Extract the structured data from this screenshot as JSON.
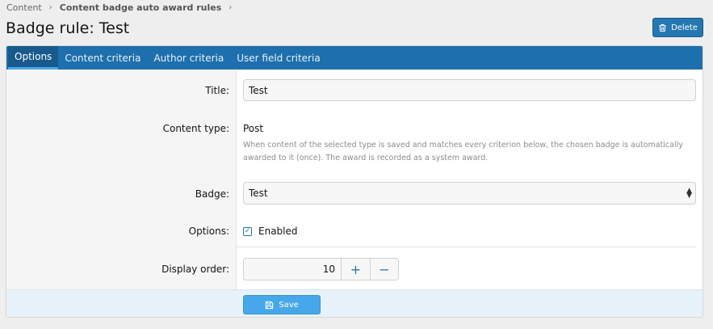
{
  "breadcrumb": [
    {
      "label": "Content"
    },
    {
      "label": "Content badge auto award rules"
    }
  ],
  "page_title": "Badge rule: Test",
  "delete_label": "Delete",
  "tabs": [
    {
      "label": "Options",
      "active": true
    },
    {
      "label": "Content criteria"
    },
    {
      "label": "Author criteria"
    },
    {
      "label": "User field criteria"
    }
  ],
  "form": {
    "title": {
      "label": "Title:",
      "value": "Test"
    },
    "content_type": {
      "label": "Content type:",
      "value": "Post",
      "explain": "When content of the selected type is saved and matches every criterion below, the chosen badge is automatically awarded to it (once). The award is recorded as a system award."
    },
    "badge": {
      "label": "Badge:",
      "value": "Test"
    },
    "options": {
      "label": "Options:",
      "enabled_label": "Enabled",
      "enabled": true
    },
    "display_order": {
      "label": "Display order:",
      "value": "10"
    }
  },
  "save_label": "Save",
  "colors": {
    "tab_bar": "#1d6fad",
    "primary_button": "#2577b1",
    "save_button": "#47a7eb"
  }
}
